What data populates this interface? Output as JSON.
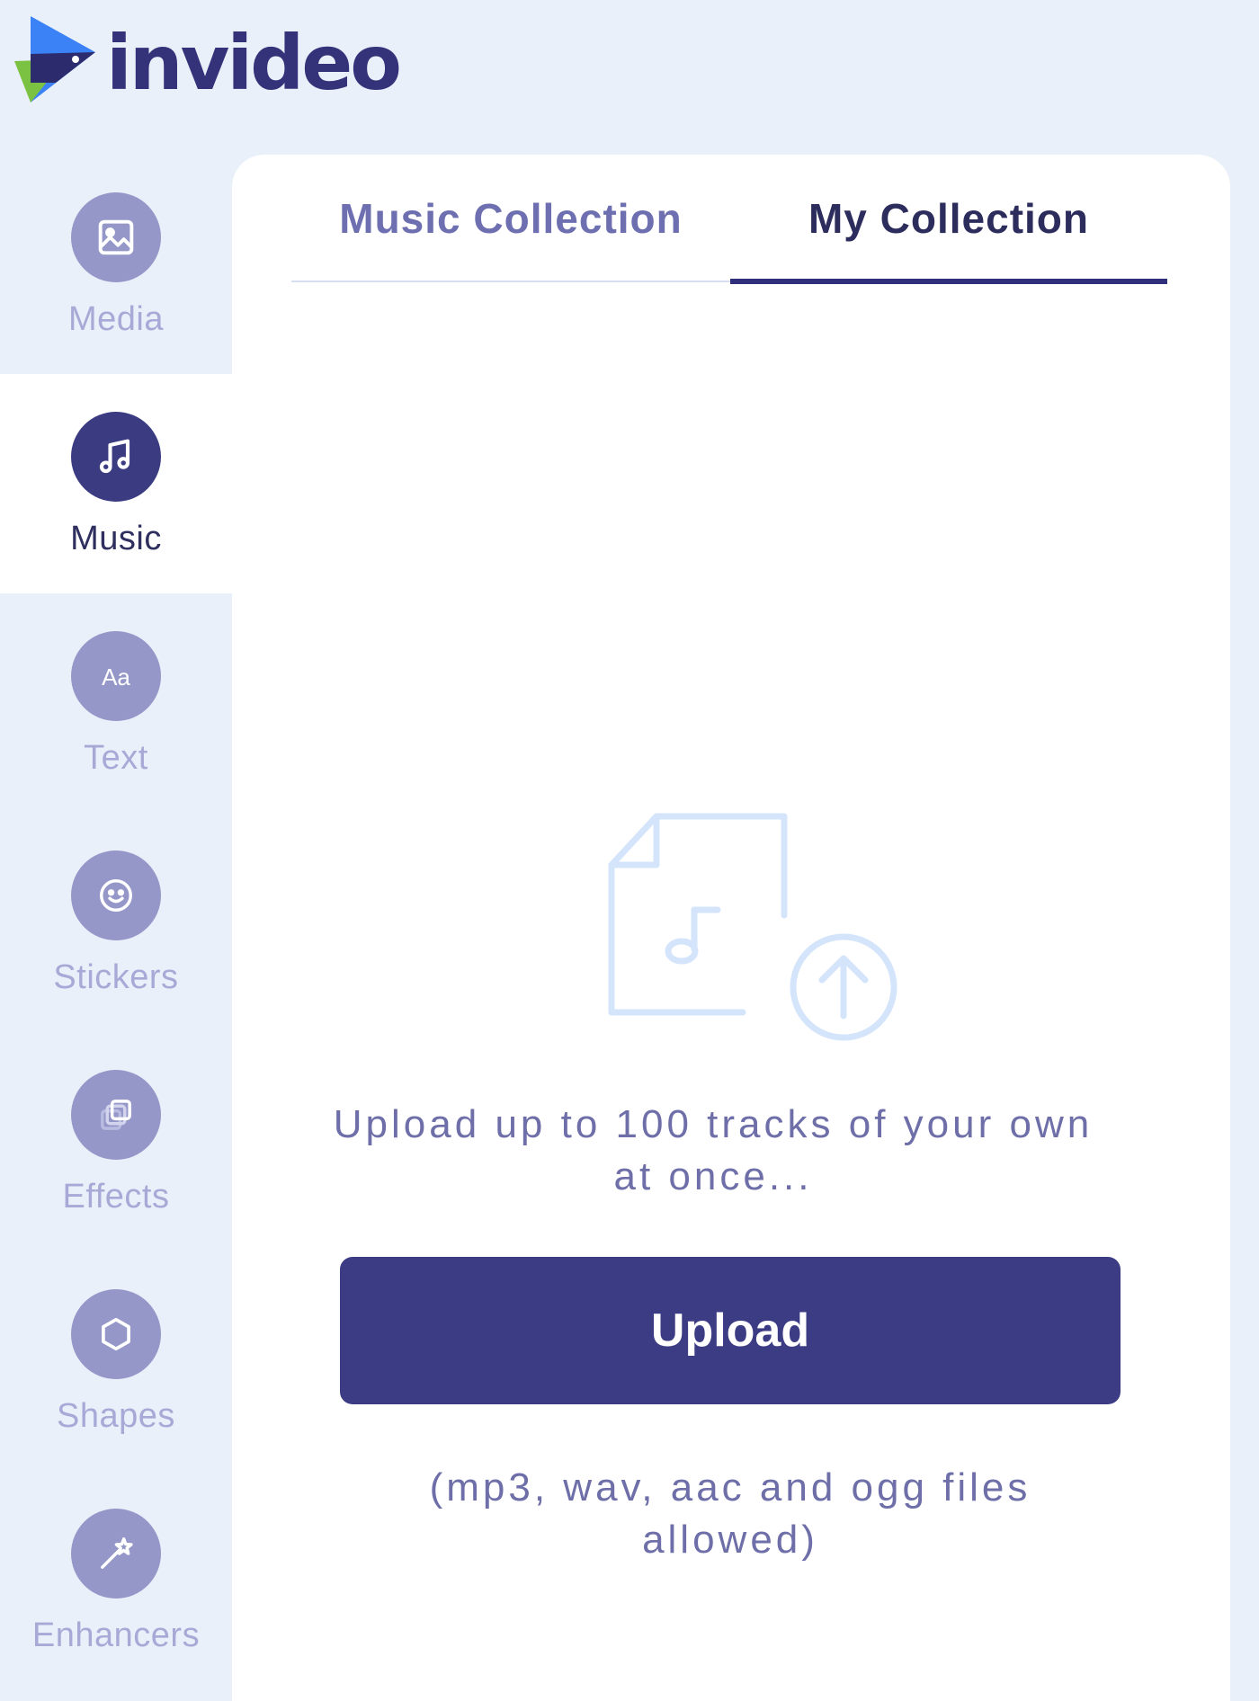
{
  "brand": {
    "name": "invideo"
  },
  "colors": {
    "accent": "#3c3c84",
    "background": "#eaf0fa",
    "inactive_icon": "#9497c7",
    "inactive_label": "#a7aad6"
  },
  "sidebar": {
    "items": [
      {
        "label": "Media",
        "icon": "image-icon",
        "active": false
      },
      {
        "label": "Music",
        "icon": "music-note-icon",
        "active": true
      },
      {
        "label": "Text",
        "icon": "text-aa-icon",
        "active": false
      },
      {
        "label": "Stickers",
        "icon": "smiley-icon",
        "active": false
      },
      {
        "label": "Effects",
        "icon": "layers-icon",
        "active": false
      },
      {
        "label": "Shapes",
        "icon": "hexagon-icon",
        "active": false
      },
      {
        "label": "Enhancers",
        "icon": "magic-wand-icon",
        "active": false
      }
    ]
  },
  "panel": {
    "tabs": [
      {
        "label": "Music Collection",
        "active": false
      },
      {
        "label": "My Collection",
        "active": true
      }
    ],
    "empty_state": {
      "icon": "music-file-upload-icon",
      "message": "Upload up to 100 tracks of your own at once...",
      "button_label": "Upload",
      "formats_note": "(mp3, wav, aac and ogg files allowed)"
    }
  }
}
